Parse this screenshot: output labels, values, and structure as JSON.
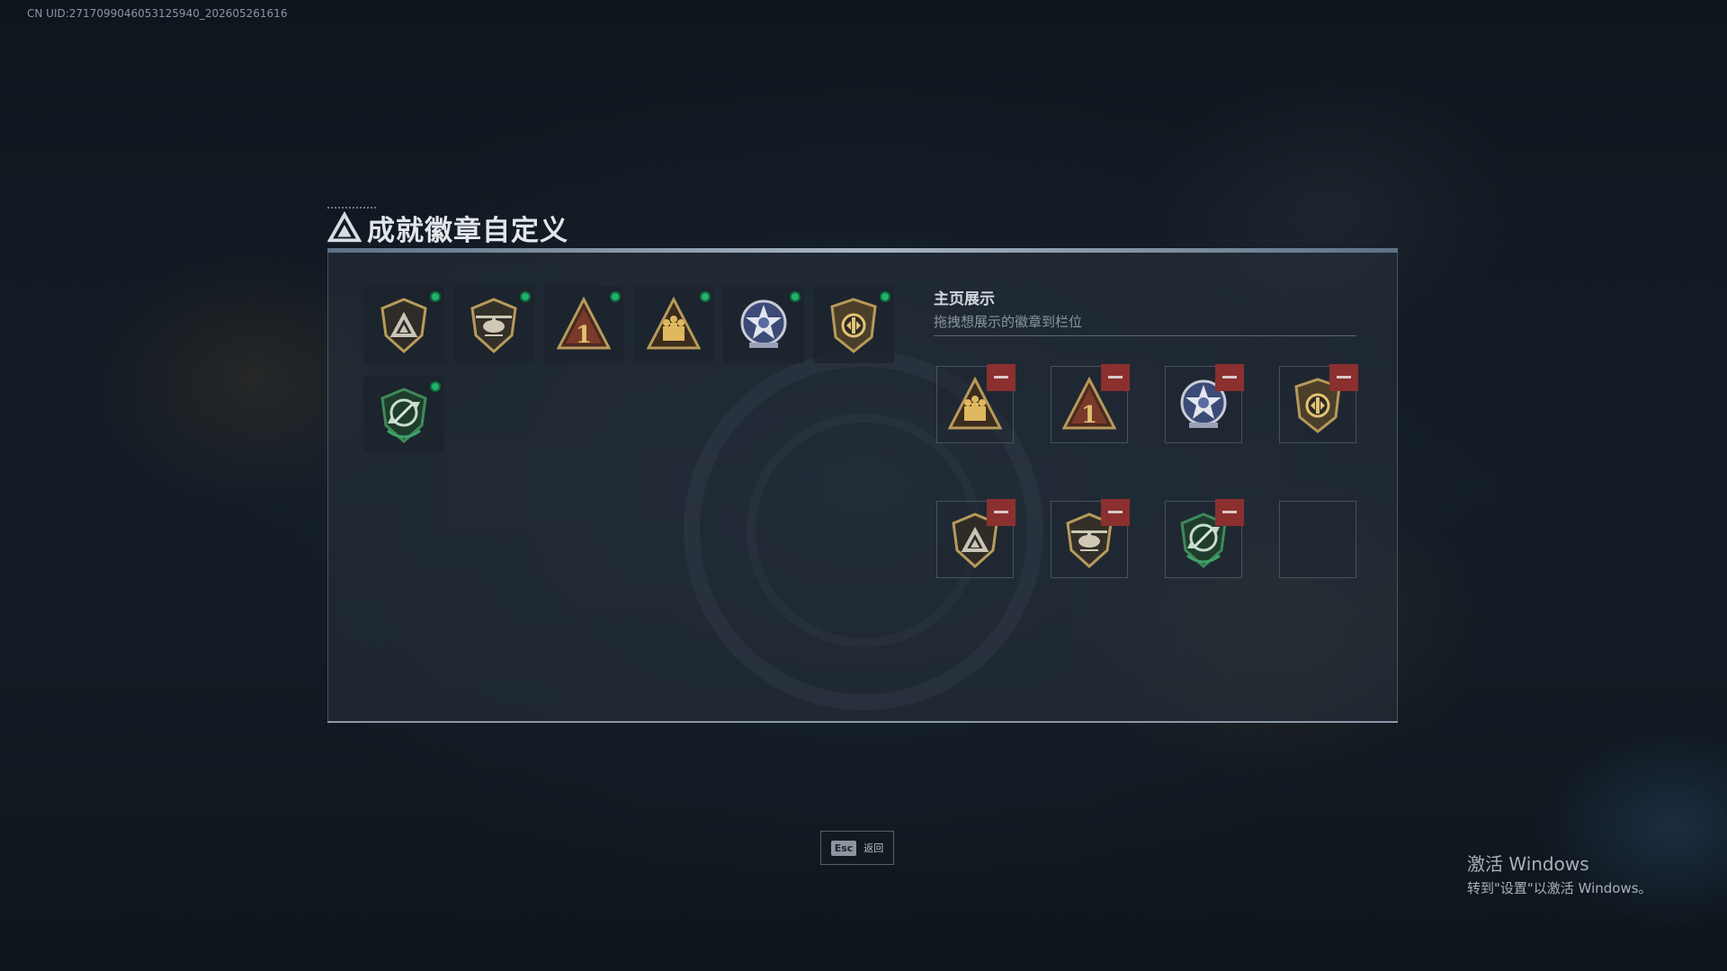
{
  "uid_text": "CN UID:271709904605312594​0_202605261616",
  "title": "成就徽章自定义",
  "showcase": {
    "title": "主页展示",
    "subtitle": "拖拽想展示的徽章到栏位"
  },
  "inventory": [
    {
      "badge": "shield-triangle-badge",
      "equipped": true
    },
    {
      "badge": "helicopter-badge",
      "equipped": true
    },
    {
      "badge": "number-one-triangle-badge",
      "equipped": true
    },
    {
      "badge": "squad-triangle-badge",
      "equipped": true
    },
    {
      "badge": "star-medal-badge",
      "equipped": true
    },
    {
      "badge": "crest-shield-badge",
      "equipped": true
    },
    {
      "badge": "green-arrows-shield-badge",
      "equipped": true
    }
  ],
  "showcase_slots": [
    {
      "badge": "squad-triangle-badge"
    },
    {
      "badge": "number-one-triangle-badge"
    },
    {
      "badge": "star-medal-badge"
    },
    {
      "badge": "crest-shield-badge"
    },
    {
      "badge": "shield-triangle-badge"
    },
    {
      "badge": "helicopter-badge"
    },
    {
      "badge": "green-arrows-shield-badge"
    },
    {
      "badge": null
    }
  ],
  "footer": {
    "esc_key": "Esc",
    "esc_label": "返回"
  },
  "watermark": {
    "title": "激活 Windows",
    "subtitle": "转到\"设置\"以激活 Windows。"
  },
  "colors": {
    "equipped_dot": "#21b36b",
    "remove_button": "#8c2f2f",
    "gold": "#b89a5a",
    "green": "#3e8a5a"
  }
}
